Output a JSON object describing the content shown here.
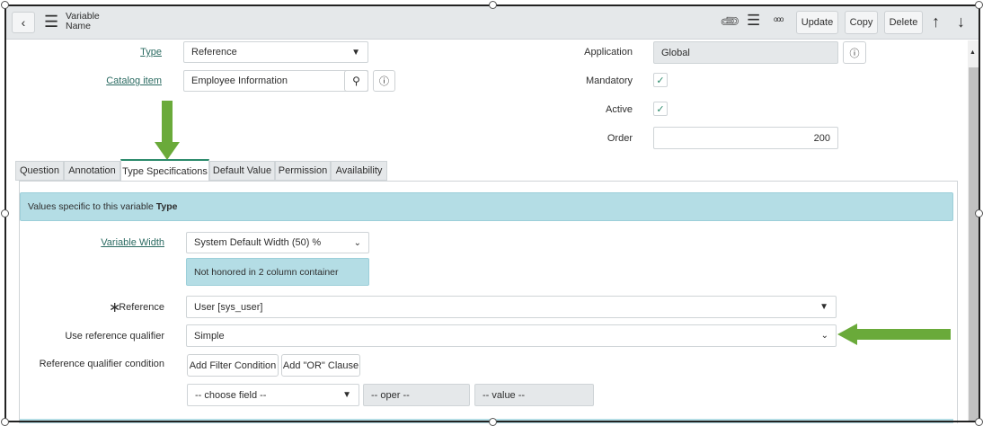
{
  "header": {
    "title": "Variable",
    "subtitle": "Name",
    "update": "Update",
    "copy": "Copy",
    "delete": "Delete"
  },
  "form": {
    "type_label": "Type",
    "type_value": "Reference",
    "catalog_label": "Catalog item",
    "catalog_value": "Employee Information",
    "application_label": "Application",
    "application_value": "Global",
    "mandatory_label": "Mandatory",
    "active_label": "Active",
    "order_label": "Order",
    "order_value": "200"
  },
  "tabs": [
    "Question",
    "Annotation",
    "Type Specifications",
    "Default Value",
    "Permission",
    "Availability"
  ],
  "panel": {
    "info_text": "Values specific to this variable ",
    "info_bold": "Type",
    "width_label": "Variable Width",
    "width_value": "System Default Width (50) %",
    "width_note": "Not honored in 2 column container",
    "reference_label": "Reference",
    "reference_value": "User [sys_user]",
    "qualifier_label": "Use reference qualifier",
    "qualifier_value": "Simple",
    "condition_label": "Reference qualifier condition",
    "add_filter": "Add Filter Condition",
    "add_or": "Add \"OR\" Clause",
    "choose_field": "-- choose field --",
    "oper": "-- oper --",
    "value": "-- value --"
  },
  "colors": {
    "arrow": "#6aaa3a",
    "info": "#b4dde5",
    "accent": "#2b8a6b"
  }
}
